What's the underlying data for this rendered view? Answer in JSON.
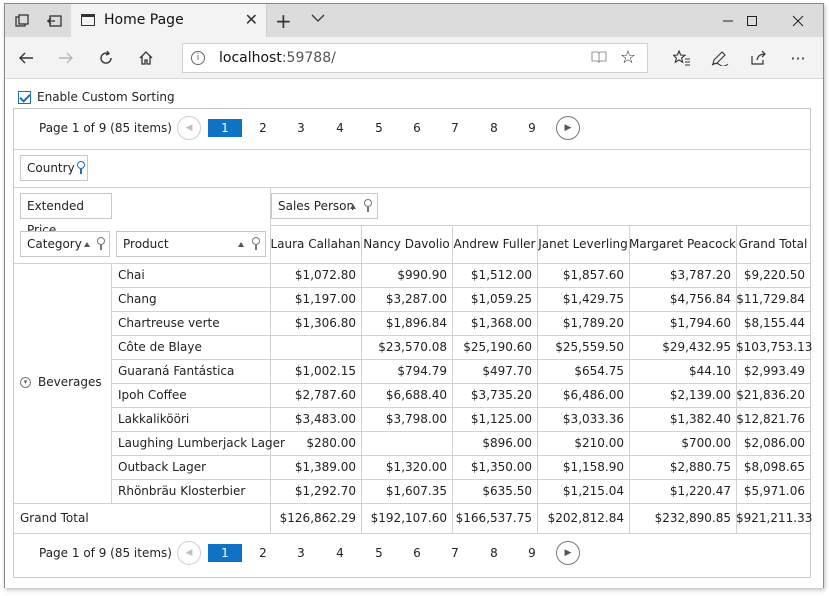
{
  "browser": {
    "tab_title": "Home Page",
    "url_host": "localhost",
    "url_port": ":59788/"
  },
  "page": {
    "checkbox_label": "Enable Custom Sorting",
    "checkbox_checked": true,
    "pager": {
      "summary": "Page 1 of 9 (85 items)",
      "pages": [
        "1",
        "2",
        "3",
        "4",
        "5",
        "6",
        "7",
        "8",
        "9"
      ],
      "active_page": "1"
    },
    "filter_area": {
      "country": "Country"
    },
    "data_area": {
      "extended_price": "Extended Price"
    },
    "column_area": {
      "sales_person": "Sales Person"
    },
    "row_area": {
      "category": "Category",
      "product": "Product"
    },
    "columns": [
      "Laura Callahan",
      "Nancy Davolio",
      "Andrew Fuller",
      "Janet Leverling",
      "Margaret Peacock",
      "Grand Total"
    ],
    "category": "Beverages",
    "rows": [
      {
        "product": "Chai",
        "values": [
          "$1,072.80",
          "$990.90",
          "$1,512.00",
          "$1,857.60",
          "$3,787.20",
          "$9,220.50"
        ]
      },
      {
        "product": "Chang",
        "values": [
          "$1,197.00",
          "$3,287.00",
          "$1,059.25",
          "$1,429.75",
          "$4,756.84",
          "$11,729.84"
        ]
      },
      {
        "product": "Chartreuse verte",
        "values": [
          "$1,306.80",
          "$1,896.84",
          "$1,368.00",
          "$1,789.20",
          "$1,794.60",
          "$8,155.44"
        ]
      },
      {
        "product": "Côte de Blaye",
        "values": [
          "",
          "$23,570.08",
          "$25,190.60",
          "$25,559.50",
          "$29,432.95",
          "$103,753.13"
        ]
      },
      {
        "product": "Guaraná Fantástica",
        "values": [
          "$1,002.15",
          "$794.79",
          "$497.70",
          "$654.75",
          "$44.10",
          "$2,993.49"
        ]
      },
      {
        "product": "Ipoh Coffee",
        "values": [
          "$2,787.60",
          "$6,688.40",
          "$3,735.20",
          "$6,486.00",
          "$2,139.00",
          "$21,836.20"
        ]
      },
      {
        "product": "Lakkalikööri",
        "values": [
          "$3,483.00",
          "$3,798.00",
          "$1,125.00",
          "$3,033.36",
          "$1,382.40",
          "$12,821.76"
        ]
      },
      {
        "product": "Laughing Lumberjack Lager",
        "values": [
          "$280.00",
          "",
          "$896.00",
          "$210.00",
          "$700.00",
          "$2,086.00"
        ]
      },
      {
        "product": "Outback Lager",
        "values": [
          "$1,389.00",
          "$1,320.00",
          "$1,350.00",
          "$1,158.90",
          "$2,880.75",
          "$8,098.65"
        ]
      },
      {
        "product": "Rhönbräu Klosterbier",
        "values": [
          "$1,292.70",
          "$1,607.35",
          "$635.50",
          "$1,215.04",
          "$1,220.47",
          "$5,971.06"
        ]
      }
    ],
    "grand_total": {
      "label": "Grand Total",
      "values": [
        "$126,862.29",
        "$192,107.60",
        "$166,537.75",
        "$202,812.84",
        "$232,890.85",
        "$921,211.33"
      ]
    }
  }
}
